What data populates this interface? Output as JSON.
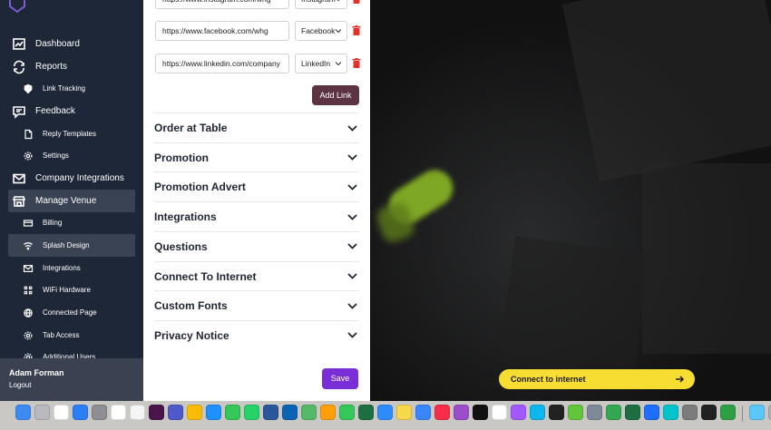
{
  "sidebar": {
    "items": [
      {
        "label": "Dashboard",
        "icon": "chart-icon",
        "level": "top",
        "active": false
      },
      {
        "label": "Reports",
        "icon": "refresh-icon",
        "level": "top",
        "active": false
      },
      {
        "label": "Link Tracking",
        "icon": "badge-icon",
        "level": "sub",
        "active": false
      },
      {
        "label": "Feedback",
        "icon": "message-icon",
        "level": "top",
        "active": false
      },
      {
        "label": "Reply Templates",
        "icon": "document-icon",
        "level": "sub",
        "active": false
      },
      {
        "label": "Settings",
        "icon": "gear-icon",
        "level": "sub",
        "active": false
      },
      {
        "label": "Company Integrations",
        "icon": "mail-icon",
        "level": "top",
        "active": false
      },
      {
        "label": "Manage Venue",
        "icon": "store-icon",
        "level": "top",
        "active": true
      },
      {
        "label": "Billing",
        "icon": "card-icon",
        "level": "sub",
        "active": false
      },
      {
        "label": "Splash Design",
        "icon": "wifi-icon",
        "level": "sub",
        "active": true
      },
      {
        "label": "Integrations",
        "icon": "mail-icon",
        "level": "sub",
        "active": false
      },
      {
        "label": "WiFi Hardware",
        "icon": "grid-icon",
        "level": "sub",
        "active": false
      },
      {
        "label": "Connected Page",
        "icon": "globe-icon",
        "level": "sub",
        "active": false
      },
      {
        "label": "Tab Access",
        "icon": "gear-icon",
        "level": "sub",
        "active": false
      },
      {
        "label": "Additional Users",
        "icon": "gear-icon",
        "level": "sub",
        "active": false
      }
    ],
    "user": {
      "name": "Adam Forman",
      "logout": "Logout"
    }
  },
  "links": [
    {
      "url": "https://www.instagram.com/whg",
      "network": "Instagram"
    },
    {
      "url": "https://www.facebook.com/whg",
      "network": "Facebook"
    },
    {
      "url": "https://www.linkedin.com/company",
      "network": "LinkedIn"
    }
  ],
  "add_link_label": "Add Link",
  "sections": [
    "Order at Table",
    "Promotion",
    "Promotion Advert",
    "Integrations",
    "Questions",
    "Connect To Internet",
    "Custom Fonts",
    "Privacy Notice"
  ],
  "save_label": "Save",
  "preview": {
    "connect_label": "Connect to internet"
  },
  "colors": {
    "sidebar": "#1e2738",
    "accent": "#7a2ed8",
    "add_link": "#5b3343",
    "connect": "#f7dd32"
  },
  "dock": [
    "finder",
    "launchpad",
    "calendar",
    "app-store",
    "settings",
    "calendar2",
    "reminders",
    "slack",
    "teams",
    "chrome",
    "safari",
    "messages",
    "whatsapp",
    "word",
    "outlook",
    "maps",
    "photos",
    "facetime",
    "excel",
    "zoom",
    "notes",
    "mail",
    "music",
    "podcasts",
    "tv",
    "notion",
    "figma",
    "docker",
    "cursor",
    "webex",
    "preview",
    "numbers",
    "excel2",
    "keynote",
    "canva",
    "calculator",
    "terminal",
    "activity",
    "downloads",
    "trash"
  ]
}
